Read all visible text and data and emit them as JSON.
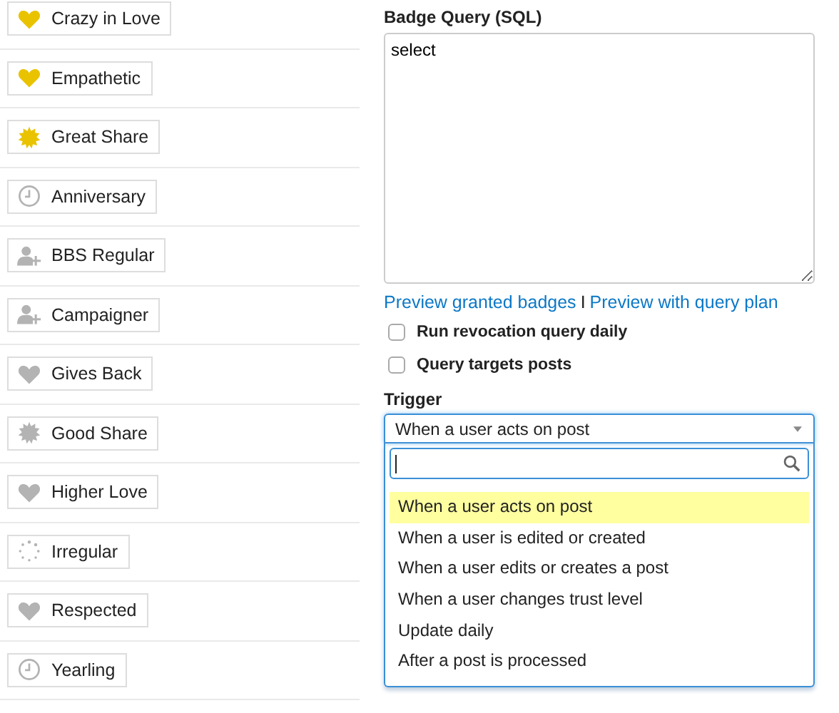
{
  "badges": [
    {
      "name": "Crazy in Love",
      "kind": "heart",
      "color": "#e9c300"
    },
    {
      "name": "Empathetic",
      "kind": "heart",
      "color": "#e9c300"
    },
    {
      "name": "Great Share",
      "kind": "burst",
      "color": "#e9c300"
    },
    {
      "name": "Anniversary",
      "kind": "clock",
      "color": "#b3b3b3"
    },
    {
      "name": "BBS Regular",
      "kind": "user",
      "color": "#b3b3b3"
    },
    {
      "name": "Campaigner",
      "kind": "user",
      "color": "#b3b3b3"
    },
    {
      "name": "Gives Back",
      "kind": "heart",
      "color": "#b3b3b3"
    },
    {
      "name": "Good Share",
      "kind": "burst",
      "color": "#b3b3b3"
    },
    {
      "name": "Higher Love",
      "kind": "heart",
      "color": "#b3b3b3"
    },
    {
      "name": "Irregular",
      "kind": "dots",
      "color": "#b3b3b3"
    },
    {
      "name": "Respected",
      "kind": "heart",
      "color": "#b3b3b3"
    },
    {
      "name": "Yearling",
      "kind": "clock",
      "color": "#b3b3b3"
    }
  ],
  "query": {
    "label": "Badge Query (SQL)",
    "value": "select"
  },
  "links": [
    "Preview granted badges",
    "Preview with query plan"
  ],
  "link_separator": "I",
  "options": [
    {
      "label": "Run revocation query daily",
      "checked": false
    },
    {
      "label": "Query targets posts",
      "checked": false
    }
  ],
  "trigger": {
    "label": "Trigger",
    "value": "When a user acts on post",
    "expanded": true,
    "choices": [
      {
        "label": "When a user acts on post",
        "selected": true
      },
      {
        "label": "When a user is edited or created",
        "selected": false
      },
      {
        "label": "When a user edits or creates a post",
        "selected": false
      },
      {
        "label": "When a user changes trust level",
        "selected": false
      },
      {
        "label": "Update daily",
        "selected": false
      },
      {
        "label": "After a post is processed",
        "selected": false
      }
    ]
  }
}
